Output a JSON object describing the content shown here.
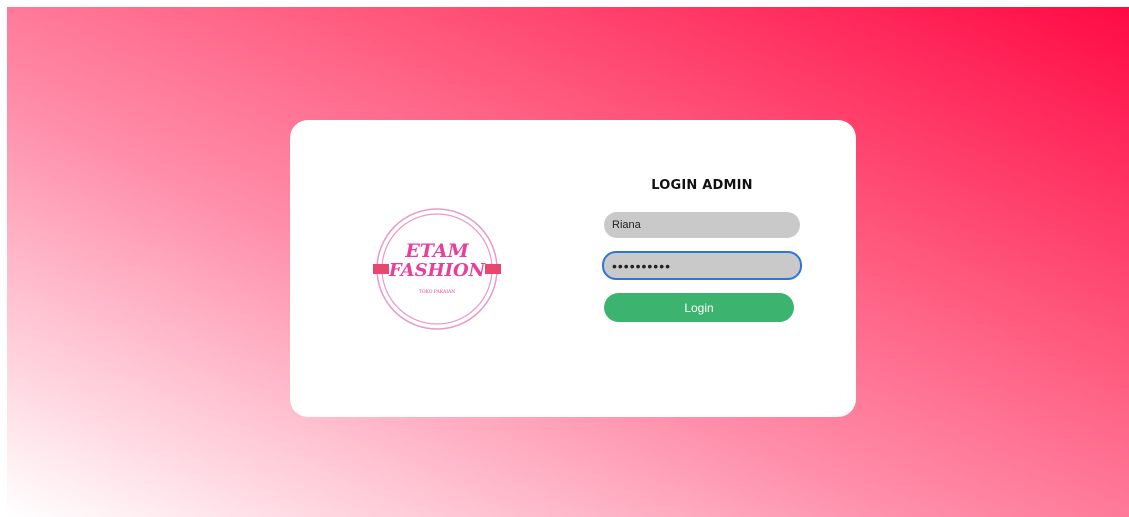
{
  "form": {
    "title": "LOGIN ADMIN",
    "username_value": "Riana",
    "password_value": "••••••••••",
    "login_label": "Login"
  },
  "logo": {
    "line1": "ETAM",
    "line2": "FASHION",
    "tagline": "TOKO PAKAIAN"
  },
  "colors": {
    "gradient_start": "#ffffff",
    "gradient_end": "#ff0a44",
    "brand_pink": "#e6409a",
    "banner_pink": "#e8486e",
    "button_green": "#3db370",
    "focus_blue": "#2f74d9"
  }
}
